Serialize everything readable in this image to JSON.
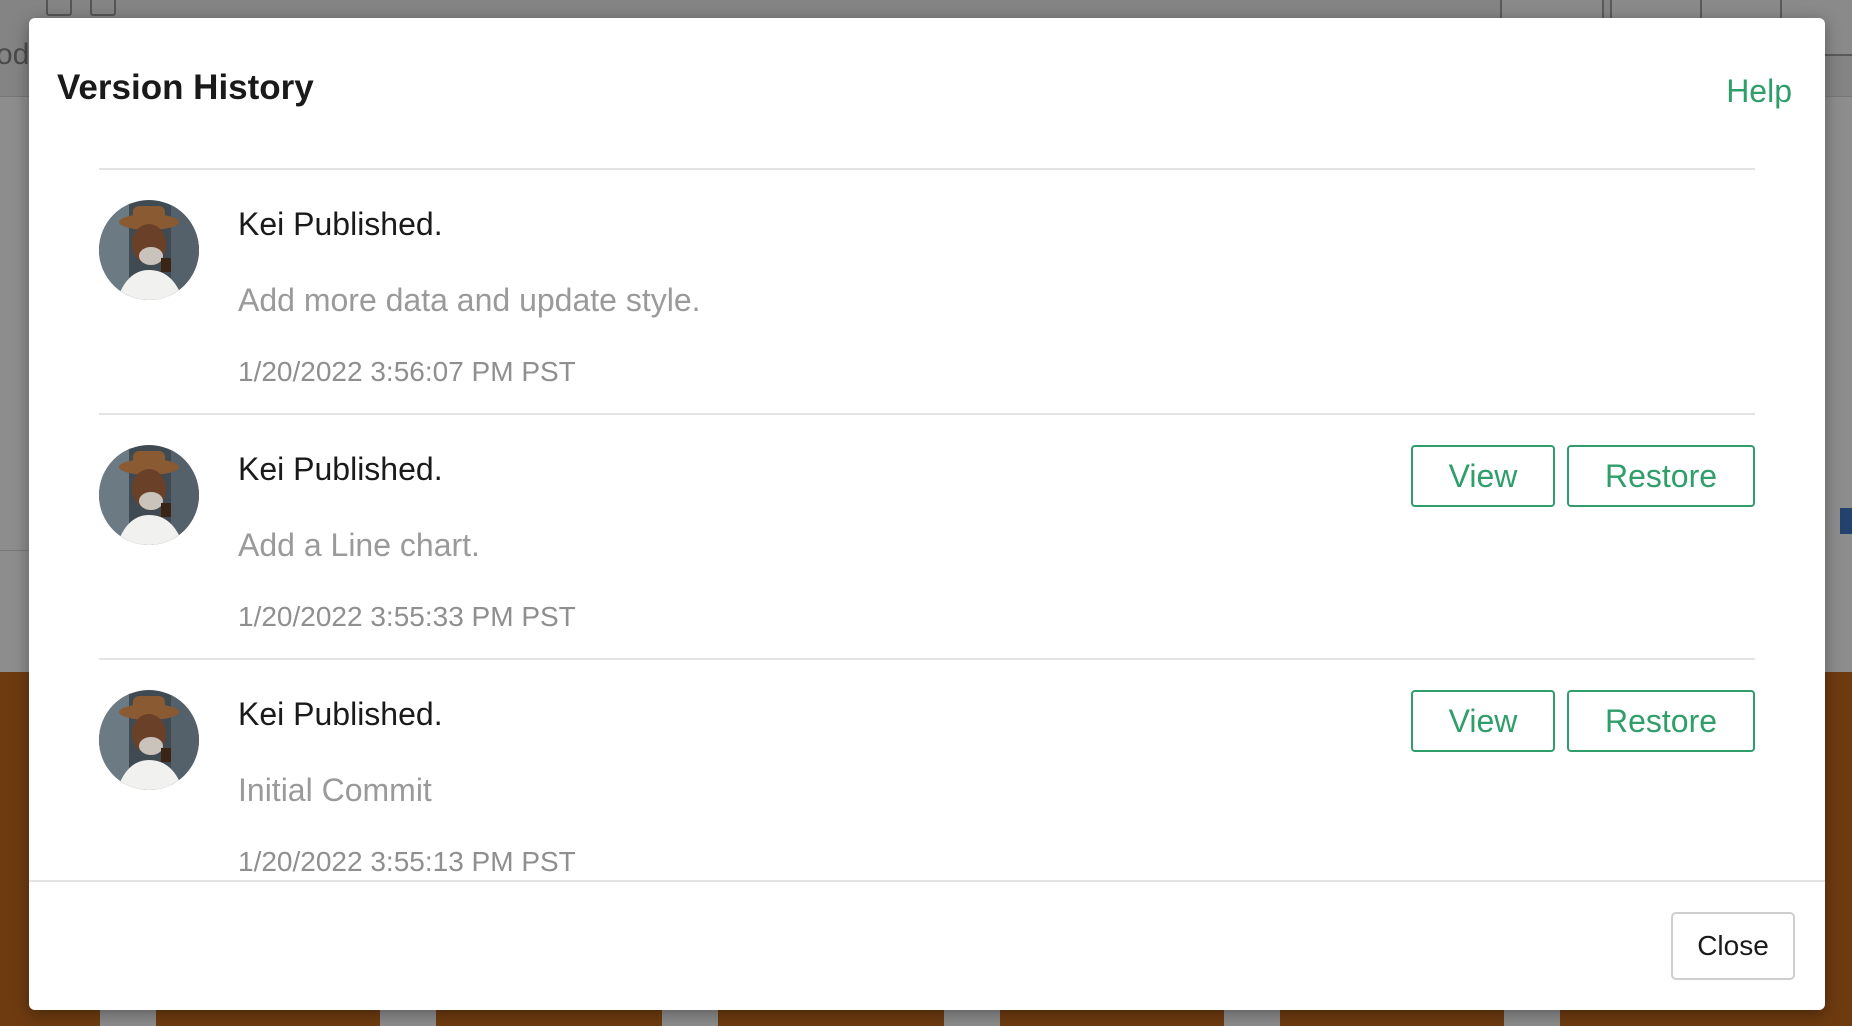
{
  "background": {
    "partial_text": "oda"
  },
  "modal": {
    "title": "Version History",
    "help_label": "Help",
    "versions": [
      {
        "author_action": "Kei Published.",
        "message": "Add more data and update style.",
        "timestamp": "1/20/2022 3:56:07 PM PST",
        "show_actions": false
      },
      {
        "author_action": "Kei Published.",
        "message": "Add a Line chart.",
        "timestamp": "1/20/2022 3:55:33 PM PST",
        "show_actions": true,
        "view_label": "View",
        "restore_label": "Restore"
      },
      {
        "author_action": "Kei Published.",
        "message": "Initial Commit",
        "timestamp": "1/20/2022 3:55:13 PM PST",
        "show_actions": true,
        "view_label": "View",
        "restore_label": "Restore"
      }
    ],
    "close_label": "Close"
  },
  "colors": {
    "accent": "#2f9e6a",
    "overlay_gray": "#8d8d8d",
    "chart_brown": "#6e3b10"
  },
  "icons": [
    "user-avatar-photo"
  ]
}
